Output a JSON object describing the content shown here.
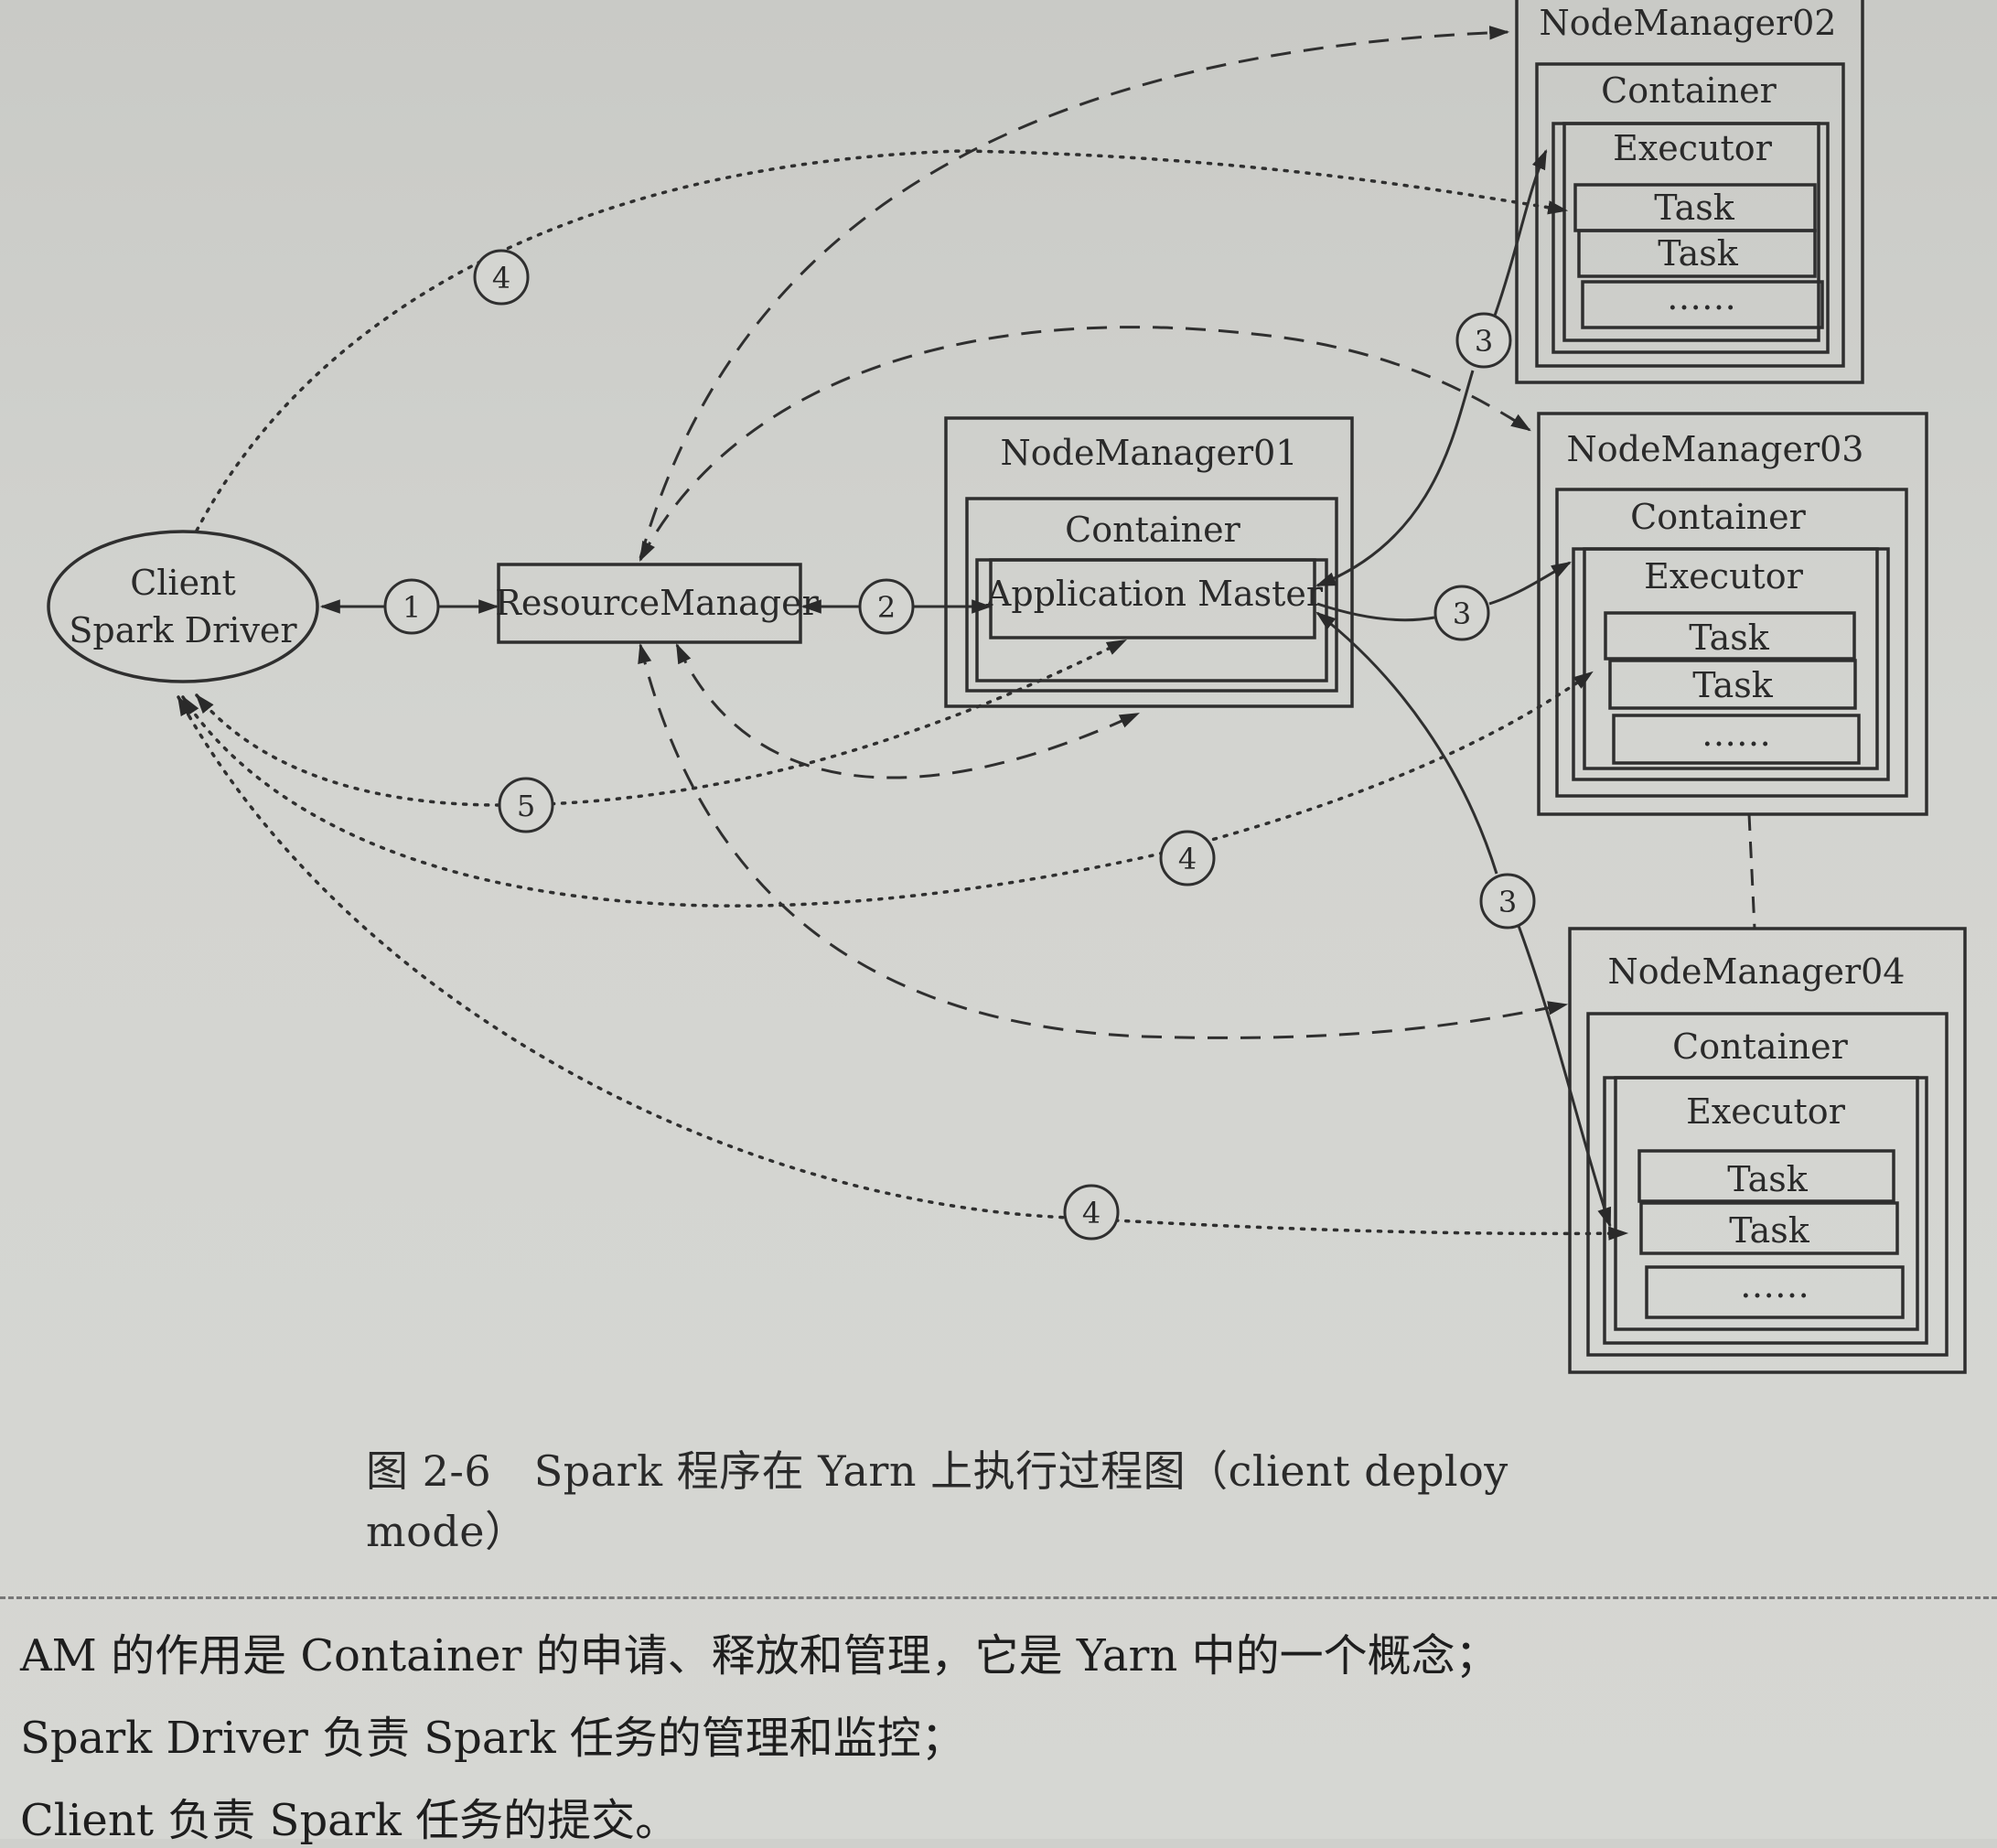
{
  "diagram": {
    "client": {
      "line1": "Client",
      "line2": "Spark Driver"
    },
    "resource_manager": "ResourceManager",
    "node_managers": [
      {
        "id": "nm01",
        "title": "NodeManager01",
        "container": "Container",
        "inner": "Application Master"
      },
      {
        "id": "nm02",
        "title": "NodeManager02",
        "container": "Container",
        "executor": "Executor",
        "tasks": [
          "Task",
          "Task",
          "……"
        ]
      },
      {
        "id": "nm03",
        "title": "NodeManager03",
        "container": "Container",
        "executor": "Executor",
        "tasks": [
          "Task",
          "Task",
          "……"
        ]
      },
      {
        "id": "nm04",
        "title": "NodeManager04",
        "container": "Container",
        "executor": "Executor",
        "tasks": [
          "Task",
          "Task",
          "……"
        ]
      }
    ],
    "steps": {
      "s1": "1",
      "s2": "2",
      "s3a": "3",
      "s3b": "3",
      "s3c": "3",
      "s4a": "4",
      "s4b": "4",
      "s4c": "4",
      "s5": "5"
    }
  },
  "caption": "图 2-6　Spark 程序在 Yarn 上执行过程图（client deploy mode）",
  "notes": [
    "AM 的作用是 Container 的申请、释放和管理，它是 Yarn 中的一个概念；",
    "Spark Driver 负责 Spark 任务的管理和监控；",
    "Client 负责 Spark 任务的提交。"
  ]
}
